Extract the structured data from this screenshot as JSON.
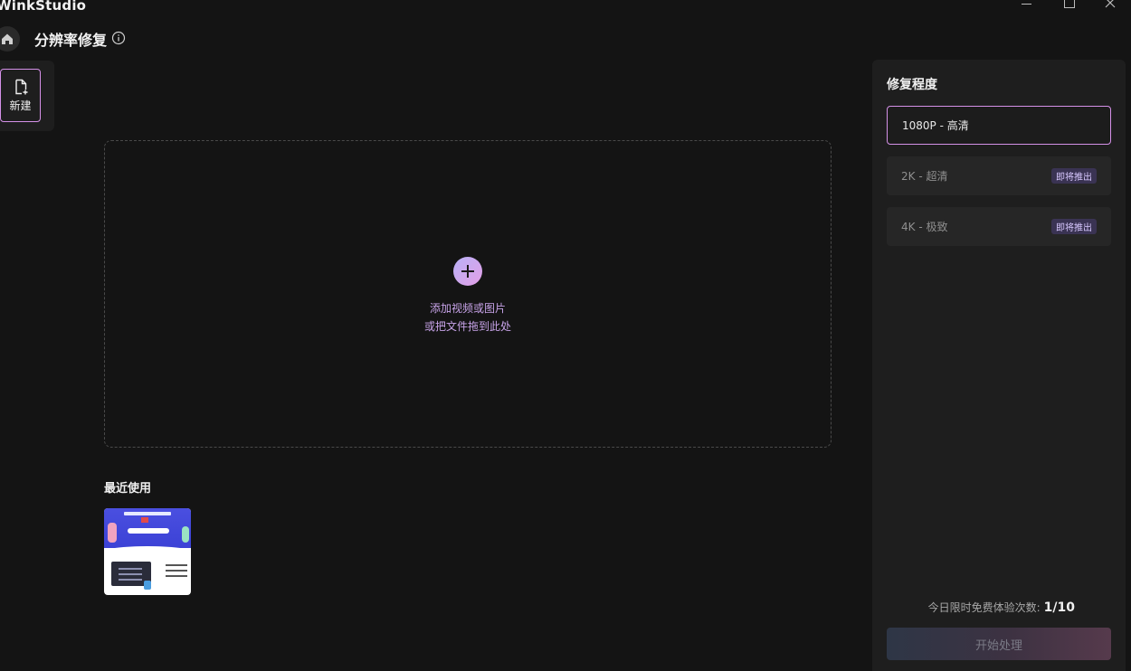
{
  "app": {
    "name": "WinkStudio"
  },
  "header": {
    "title": "分辨率修复"
  },
  "sidebar": {
    "new_label": "新建"
  },
  "dropzone": {
    "line1": "添加视频或图片",
    "line2": "或把文件拖到此处"
  },
  "recent": {
    "title": "最近使用"
  },
  "panel": {
    "title": "修复程度",
    "options": [
      {
        "label": "1080P - 高清",
        "selected": true
      },
      {
        "label": "2K - 超清",
        "badge": "即将推出"
      },
      {
        "label": "4K - 极致",
        "badge": "即将推出"
      }
    ],
    "trial_text": "今日限时免费体验次数:",
    "trial_count": "1/10",
    "start_label": "开始处理"
  },
  "colors": {
    "background": "#141414",
    "panel": "#1e1e1e",
    "accent": "#d591e8",
    "drop_text": "#c7a3e8",
    "badge_bg": "#3a3353"
  },
  "icons": {
    "home": "home-icon",
    "info": "info-icon",
    "new_file": "file-plus-icon",
    "add": "plus-icon",
    "minimize": "minimize-icon",
    "maximize": "maximize-icon",
    "close": "close-icon"
  }
}
